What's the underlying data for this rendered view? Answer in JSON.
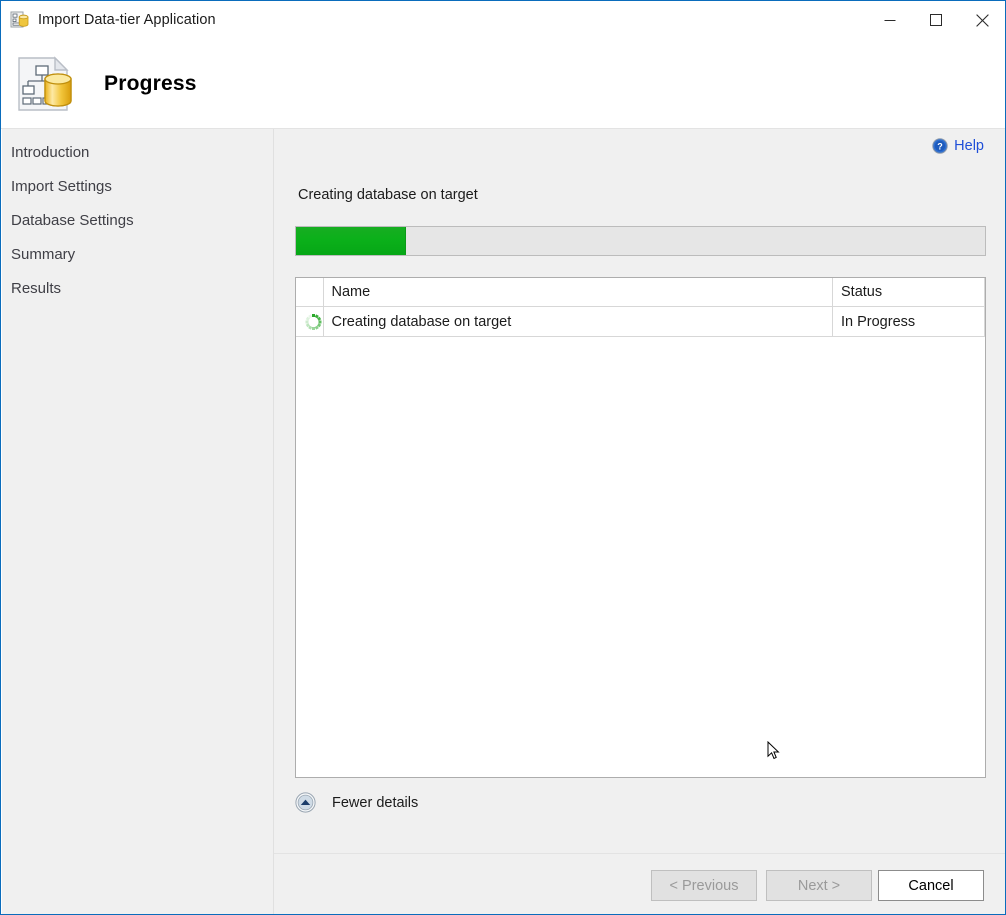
{
  "window": {
    "title": "Import Data-tier Application",
    "title_icon": "datatier-app-icon",
    "controls": {
      "minimize": "minimize-icon",
      "maximize": "maximize-icon",
      "close": "close-icon"
    }
  },
  "header": {
    "title": "Progress",
    "icon": "datatier-database-document-icon"
  },
  "sidebar": {
    "items": [
      {
        "label": "Introduction"
      },
      {
        "label": "Import Settings"
      },
      {
        "label": "Database Settings"
      },
      {
        "label": "Summary"
      },
      {
        "label": "Results"
      }
    ]
  },
  "main": {
    "help": {
      "label": "Help",
      "icon": "help-circle-icon"
    },
    "status_text": "Creating database on target",
    "progress": {
      "percent": 16,
      "fill_color": "#0bb01a",
      "track_color": "#e6e6e6"
    },
    "table": {
      "columns": [
        "",
        "Name",
        "Status"
      ],
      "rows": [
        {
          "icon": "spinner-icon",
          "name": "Creating database on target",
          "status": "In Progress"
        }
      ]
    },
    "details_toggle": {
      "label": "Fewer details",
      "icon": "chevron-up-circle-icon"
    }
  },
  "footer": {
    "previous_label": "< Previous",
    "next_label": "Next >",
    "cancel_label": "Cancel"
  }
}
